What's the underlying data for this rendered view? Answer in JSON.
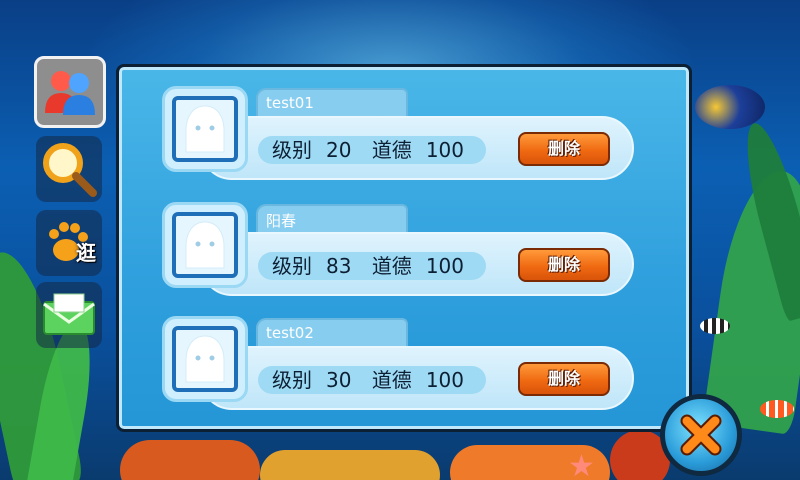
{
  "sidebar": {
    "tools": [
      {
        "icon": "friends-icon",
        "active": true
      },
      {
        "icon": "search-icon",
        "active": false
      },
      {
        "icon": "paw-icon",
        "label": "逛"
      },
      {
        "icon": "mail-icon",
        "active": false
      }
    ]
  },
  "friends": [
    {
      "name": "test01",
      "level_label": "级别",
      "level": "20",
      "moral_label": "道德",
      "moral": "100",
      "delete_label": "删除"
    },
    {
      "name": "阳春",
      "level_label": "级别",
      "level": "83",
      "moral_label": "道德",
      "moral": "100",
      "delete_label": "删除"
    },
    {
      "name": "test02",
      "level_label": "级别",
      "level": "30",
      "moral_label": "道德",
      "moral": "100",
      "delete_label": "删除"
    }
  ],
  "close": {
    "icon": "close-icon"
  },
  "colors": {
    "panel": "#2f9fdd",
    "delete_button": "#f06a12",
    "close_x": "#ff7a12"
  }
}
